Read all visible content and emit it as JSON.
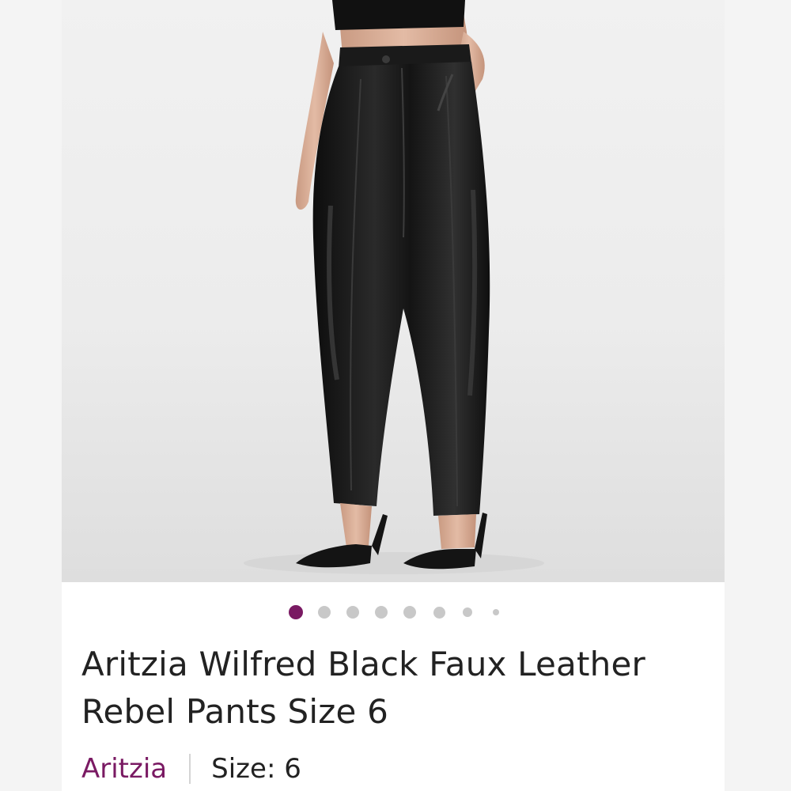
{
  "listing": {
    "title": "Aritzia Wilfred Black Faux Leather Rebel Pants Size 6",
    "brand": "Aritzia",
    "size_text": "Size: 6"
  },
  "carousel": {
    "total_images": 8,
    "active_index": 0
  },
  "colors": {
    "brand_accent": "#7a1a63",
    "dot_inactive": "#c8c8c8",
    "title_text": "#222222"
  },
  "photo": {
    "subject": "black faux leather pants",
    "icon": "product-photo"
  }
}
